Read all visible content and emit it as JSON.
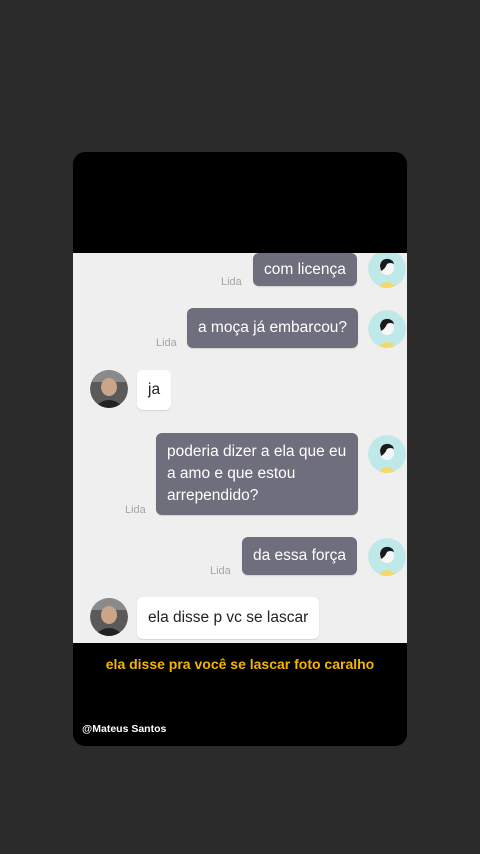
{
  "chat": {
    "messages": [
      {
        "text": "com licença",
        "from": "me",
        "status": "Lida"
      },
      {
        "text": "a moça já embarcou?",
        "from": "me",
        "status": "Lida"
      },
      {
        "text": "ja",
        "from": "contact"
      },
      {
        "text": "poderia dizer a ela que eu a amo e que estou arrependido?",
        "line1": "poderia dizer a ela que eu",
        "line2": "a amo e que estou",
        "line3": "arrependido?",
        "from": "me",
        "status": "Lida"
      },
      {
        "text": "da essa força",
        "from": "me",
        "status": "Lida"
      },
      {
        "text": "ela disse p vc se lascar",
        "from": "contact"
      }
    ]
  },
  "caption": "ela disse pra você se lascar foto caralho",
  "credit": "@Mateus Santos",
  "colors": {
    "outgoing_bubble": "#6f6e7c",
    "incoming_bubble": "#ffffff",
    "caption": "#f4b400",
    "chat_background": "#efefef"
  },
  "icons": {
    "me_avatar": "cartoon-person-avatar-icon",
    "contact_avatar": "contact-photo-avatar"
  }
}
